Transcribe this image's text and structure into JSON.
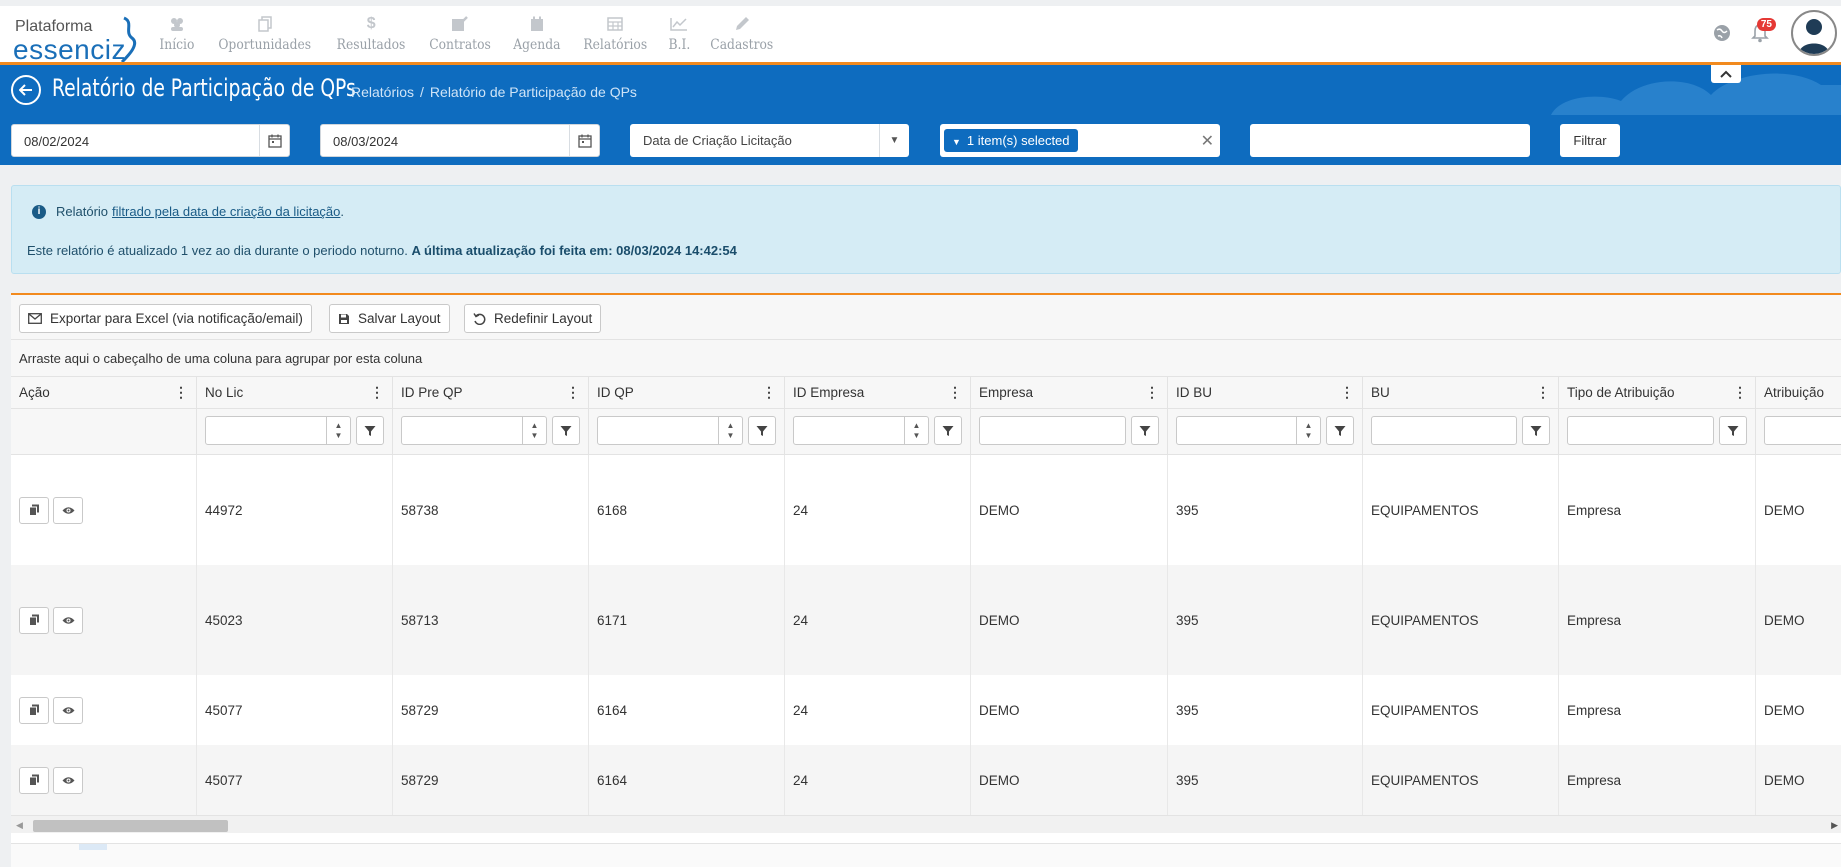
{
  "brand": {
    "line1": "Plataforma",
    "line2": "essenciz"
  },
  "nav": [
    {
      "label": "Início",
      "icon": "users-icon"
    },
    {
      "label": "Oportunidades",
      "icon": "copy-icon"
    },
    {
      "label": "Resultados",
      "icon": "dollar-icon"
    },
    {
      "label": "Contratos",
      "icon": "edit-icon"
    },
    {
      "label": "Agenda",
      "icon": "calendar-icon"
    },
    {
      "label": "Relatórios",
      "icon": "table-icon"
    },
    {
      "label": "B.I.",
      "icon": "chart-icon"
    },
    {
      "label": "Cadastros",
      "icon": "pencil-icon"
    }
  ],
  "notifications": {
    "count": "75"
  },
  "header": {
    "title": "Relatório de Participação de QPs",
    "breadcrumb": [
      "Relatórios",
      "/",
      "Relatório de Participação de QPs"
    ]
  },
  "filters": {
    "date_from": "08/02/2024",
    "date_to": "08/03/2024",
    "date_type": "Data de Criação Licitação",
    "multiselect": "1 item(s) selected",
    "filter_button": "Filtrar"
  },
  "alert": {
    "line1_prefix": "Relatório",
    "line1_link": "filtrado pela data de criação da licitação",
    "line1_suffix": ".",
    "line2_text": "Este relatório é atualizado 1 vez ao dia durante o periodo noturno.",
    "line2_bold": "A última atualização foi feita em: 08/03/2024 14:42:54"
  },
  "toolbar": {
    "export": "Exportar para Excel (via notificação/email)",
    "save": "Salvar Layout",
    "reset": "Redefinir Layout"
  },
  "group_hint": "Arraste aqui o cabeçalho de uma coluna para agrupar por esta coluna",
  "columns": [
    "Ação",
    "No Lic",
    "ID Pre QP",
    "ID QP",
    "ID Empresa",
    "Empresa",
    "ID BU",
    "BU",
    "Tipo de Atribuição",
    "Atribuição"
  ],
  "rows": [
    [
      "",
      "44972",
      "58738",
      "6168",
      "24",
      "DEMO",
      "395",
      "EQUIPAMENTOS",
      "Empresa",
      "DEMO"
    ],
    [
      "",
      "45023",
      "58713",
      "6171",
      "24",
      "DEMO",
      "395",
      "EQUIPAMENTOS",
      "Empresa",
      "DEMO"
    ],
    [
      "",
      "45077",
      "58729",
      "6164",
      "24",
      "DEMO",
      "395",
      "EQUIPAMENTOS",
      "Empresa",
      "DEMO"
    ],
    [
      "",
      "45077",
      "58729",
      "6164",
      "24",
      "DEMO",
      "395",
      "EQUIPAMENTOS",
      "Empresa",
      "DEMO"
    ]
  ],
  "colors": {
    "primary": "#0e6cbf",
    "accent": "#f28a1e",
    "alert_bg": "#d5ecf5",
    "badge": "#e53935"
  }
}
